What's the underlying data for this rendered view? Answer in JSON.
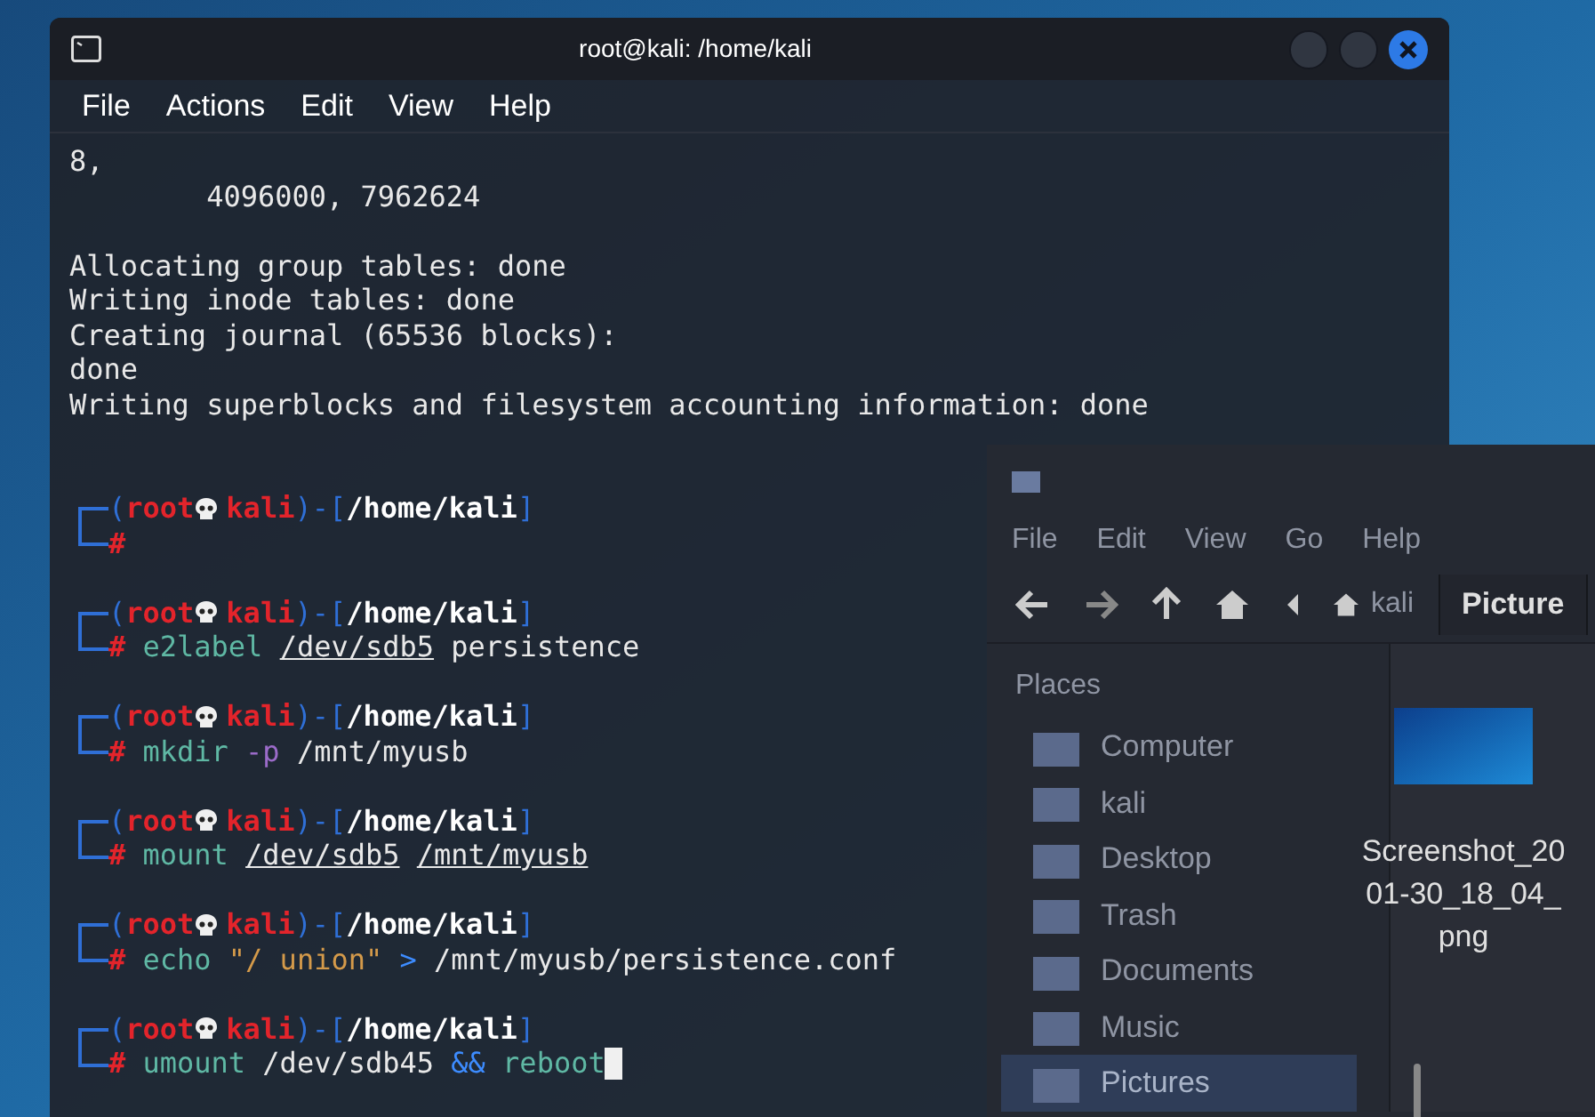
{
  "terminal": {
    "title": "root@kali: /home/kali",
    "menu": [
      "File",
      "Actions",
      "Edit",
      "View",
      "Help"
    ],
    "output_blocks": [
      [
        "8,",
        "        4096000, 7962624"
      ],
      [
        "Allocating group tables: done",
        "Writing inode tables: done",
        "Creating journal (65536 blocks):",
        "done",
        "Writing superblocks and filesystem accounting information: done"
      ]
    ],
    "prompts": [
      {
        "open": "(",
        "user": "root",
        "host": "kali",
        "middle": ")-[",
        "path": "/home/kali",
        "close": "]",
        "symbol": "#",
        "cursor": false
      },
      {
        "open": "(",
        "user": "root",
        "host": "kali",
        "middle": ")-[",
        "path": "/home/kali",
        "close": "]",
        "symbol": "#",
        "cursor": false,
        "command": [
          {
            "text": "e2label",
            "kind": "command"
          },
          {
            "text": "/dev/sdb5",
            "kind": "path"
          },
          {
            "text": "persistence",
            "kind": "plain"
          }
        ]
      },
      {
        "open": "(",
        "user": "root",
        "host": "kali",
        "middle": ")-[",
        "path": "/home/kali",
        "close": "]",
        "symbol": "#",
        "cursor": false,
        "command": [
          {
            "text": "mkdir",
            "kind": "command"
          },
          {
            "text": "-p",
            "kind": "option"
          },
          {
            "text": "/mnt/myusb",
            "kind": "plain"
          }
        ]
      },
      {
        "open": "(",
        "user": "root",
        "host": "kali",
        "middle": ")-[",
        "path": "/home/kali",
        "close": "]",
        "symbol": "#",
        "cursor": false,
        "command": [
          {
            "text": "mount",
            "kind": "command"
          },
          {
            "text": "/dev/sdb5",
            "kind": "path"
          },
          {
            "text": "/mnt/myusb",
            "kind": "path"
          }
        ]
      },
      {
        "open": "(",
        "user": "root",
        "host": "kali",
        "middle": ")-[",
        "path": "/home/kali",
        "close": "]",
        "symbol": "#",
        "cursor": false,
        "command": [
          {
            "text": "echo",
            "kind": "command"
          },
          {
            "text": "\"/ union\"",
            "kind": "string"
          },
          {
            "text": ">",
            "kind": "operator"
          },
          {
            "text": "/mnt/myusb/persistence.conf",
            "kind": "plain"
          }
        ]
      },
      {
        "open": "(",
        "user": "root",
        "host": "kali",
        "middle": ")-[",
        "path": "/home/kali",
        "close": "]",
        "symbol": "#",
        "cursor": true,
        "command": [
          {
            "text": "umount",
            "kind": "command"
          },
          {
            "text": "/dev/sdb45",
            "kind": "plain"
          },
          {
            "text": "&&",
            "kind": "operator"
          },
          {
            "text": "reboot",
            "kind": "command"
          }
        ]
      }
    ]
  },
  "file_manager": {
    "menu": [
      "File",
      "Edit",
      "View",
      "Go",
      "Help"
    ],
    "breadcrumb": "kali",
    "tab": "Picture",
    "sidebar": {
      "heading": "Places",
      "items": [
        {
          "label": "Computer",
          "selected": false
        },
        {
          "label": "kali",
          "selected": false
        },
        {
          "label": "Desktop",
          "selected": false
        },
        {
          "label": "Trash",
          "selected": false
        },
        {
          "label": "Documents",
          "selected": false
        },
        {
          "label": "Music",
          "selected": false
        },
        {
          "label": "Pictures",
          "selected": true
        }
      ]
    },
    "files": [
      {
        "name_lines": [
          "Screenshot_20",
          "01-30_18_04_",
          "png"
        ]
      }
    ]
  }
}
